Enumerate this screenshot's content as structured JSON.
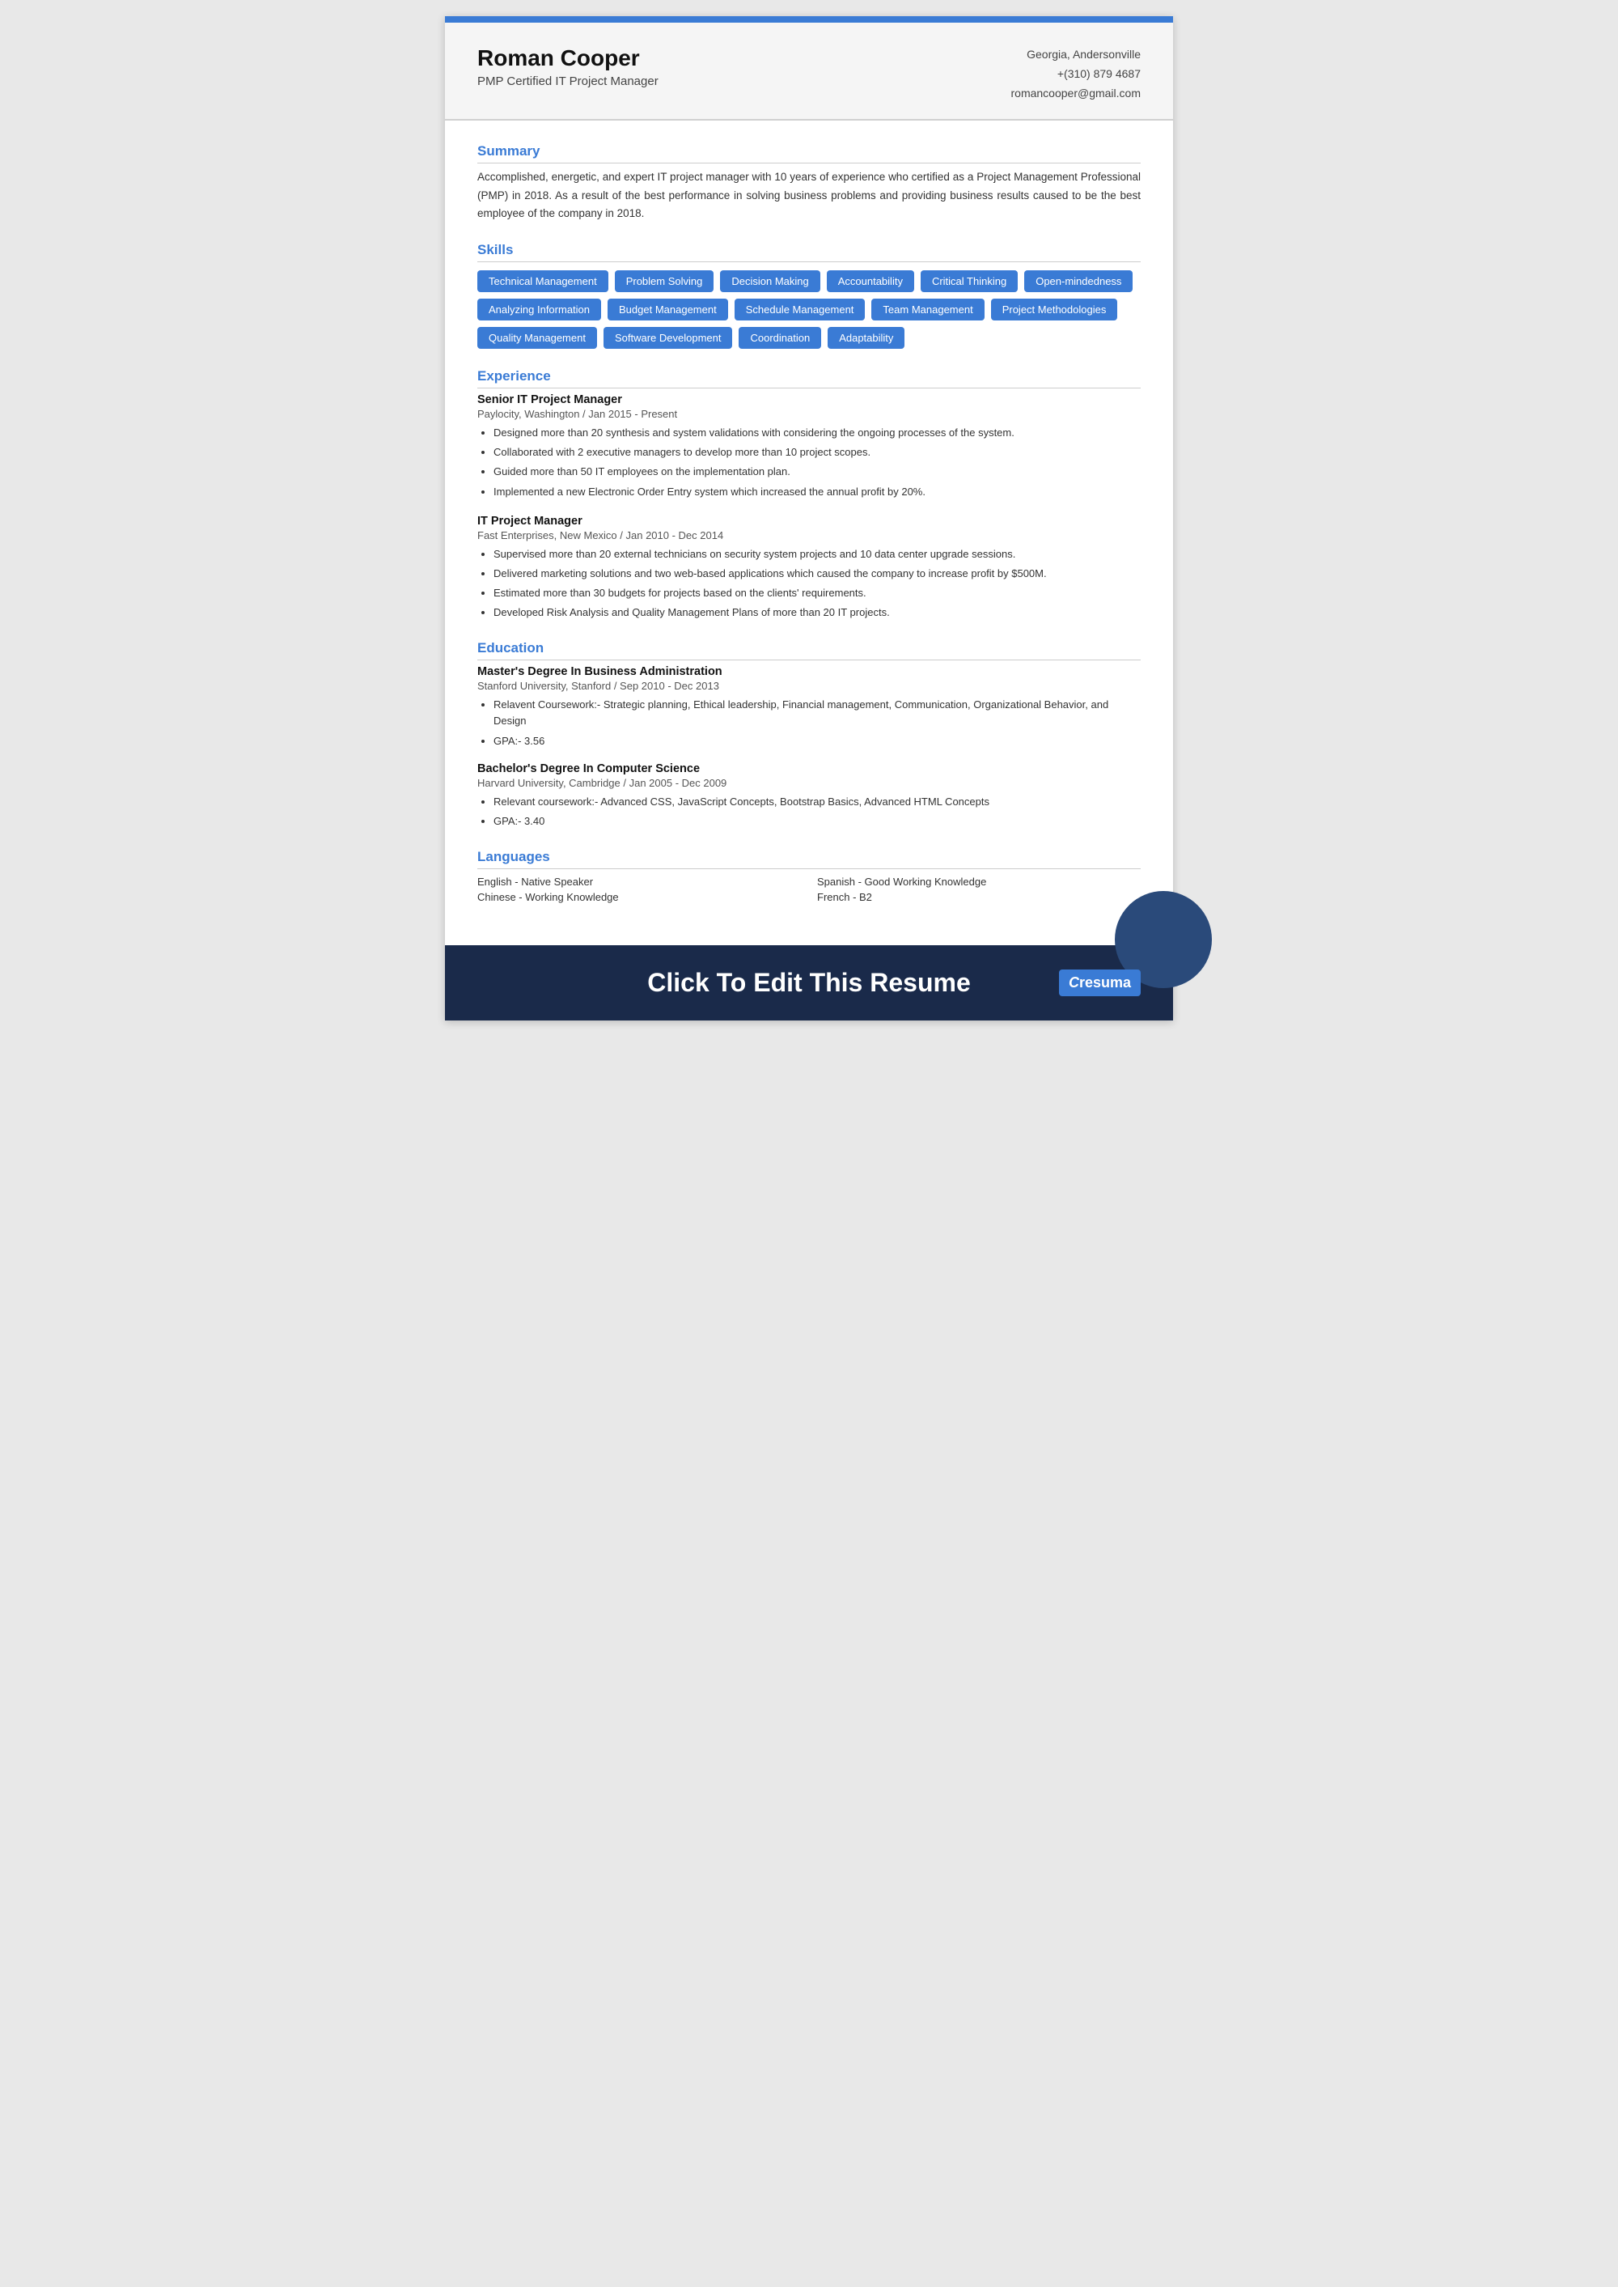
{
  "header": {
    "name": "Roman Cooper",
    "title": "PMP Certified IT Project Manager",
    "location": "Georgia, Andersonville",
    "phone": "+(310) 879 4687",
    "email": "romancooper@gmail.com"
  },
  "summary": {
    "section_title": "Summary",
    "text": "Accomplished, energetic, and expert IT project manager with 10 years of experience who certified as a Project Management Professional (PMP) in 2018. As a result of the best performance in solving business problems and providing business results caused to be the best employee of the company in 2018."
  },
  "skills": {
    "section_title": "Skills",
    "items": [
      "Technical Management",
      "Problem Solving",
      "Decision Making",
      "Accountability",
      "Critical Thinking",
      "Open-mindedness",
      "Analyzing Information",
      "Budget Management",
      "Schedule Management",
      "Team Management",
      "Project Methodologies",
      "Quality Management",
      "Software Development",
      "Coordination",
      "Adaptability"
    ]
  },
  "experience": {
    "section_title": "Experience",
    "items": [
      {
        "title": "Senior IT Project Manager",
        "company": "Paylocity, Washington / Jan 2015 - Present",
        "bullets": [
          "Designed more than 20 synthesis and system validations with considering the ongoing processes of the system.",
          "Collaborated with 2 executive managers to develop more than 10 project scopes.",
          "Guided more than 50 IT employees on the implementation plan.",
          "Implemented a new Electronic Order Entry system which increased the annual profit by 20%."
        ]
      },
      {
        "title": "IT Project Manager",
        "company": "Fast Enterprises, New Mexico / Jan 2010 - Dec 2014",
        "bullets": [
          "Supervised more than 20 external technicians on security system projects and 10 data center upgrade sessions.",
          "Delivered marketing solutions and two web-based applications which caused the company to increase profit by $500M.",
          "Estimated more than 30 budgets for projects based on the clients' requirements.",
          "Developed Risk Analysis and Quality Management Plans of more than 20 IT projects."
        ]
      }
    ]
  },
  "education": {
    "section_title": "Education",
    "items": [
      {
        "degree": "Master's Degree In Business Administration",
        "school": "Stanford University, Stanford / Sep 2010 - Dec 2013",
        "bullets": [
          "Relavent Coursework:- Strategic planning, Ethical leadership, Financial management, Communication, Organizational Behavior, and Design",
          "GPA:- 3.56"
        ]
      },
      {
        "degree": "Bachelor's Degree In Computer Science",
        "school": "Harvard University, Cambridge / Jan 2005 - Dec 2009",
        "bullets": [
          "Relevant coursework:- Advanced CSS, JavaScript Concepts,  Bootstrap Basics, Advanced HTML Concepts",
          "GPA:- 3.40"
        ]
      }
    ]
  },
  "languages": {
    "section_title": "Languages",
    "items": [
      {
        "lang": "English - Native Speaker"
      },
      {
        "lang": "Spanish - Good Working Knowledge"
      },
      {
        "lang": "Chinese - Working Knowledge"
      },
      {
        "lang": "French - B2"
      }
    ]
  },
  "footer": {
    "cta_text": "Click To Edit This Resume",
    "logo_text": "Cresuma"
  }
}
